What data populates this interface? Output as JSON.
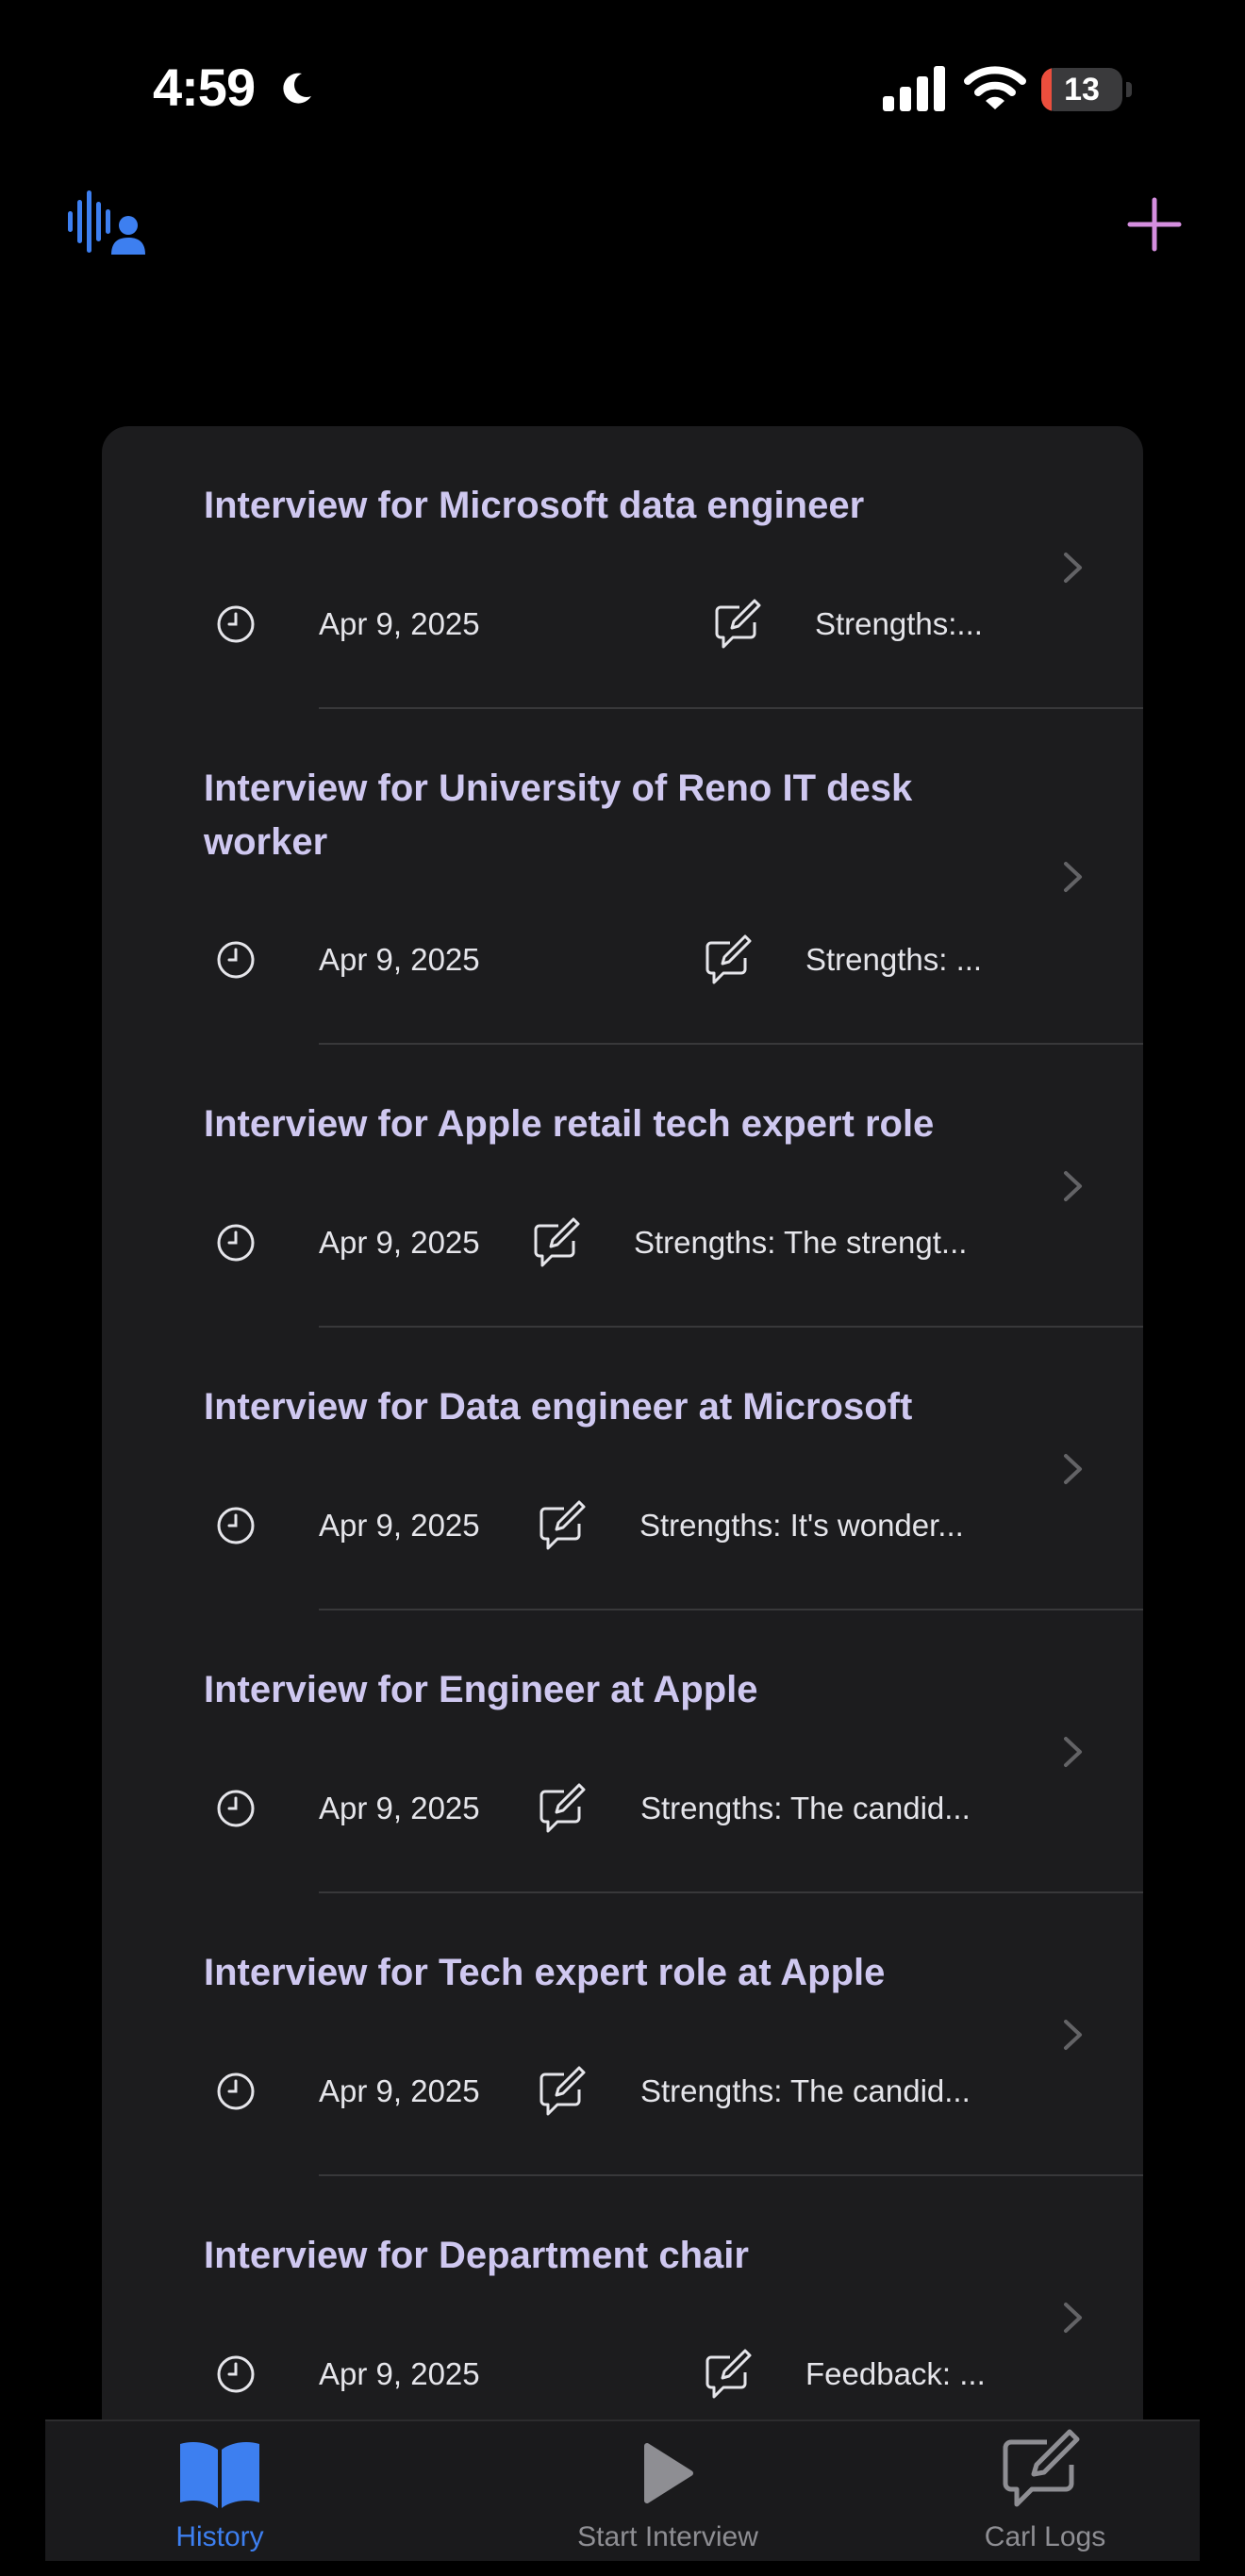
{
  "status": {
    "time": "4:59",
    "battery": "13",
    "battery_level": 0.13
  },
  "nav": {
    "voice_icon": "voice-profile-icon",
    "add_icon": "plus-icon"
  },
  "interviews": [
    {
      "title": "Interview for Microsoft data engineer",
      "date": "Apr 9, 2025",
      "summary": "Strengths:..."
    },
    {
      "title": "Interview for University of Reno IT desk worker",
      "date": "Apr 9, 2025",
      "summary": "Strengths: ..."
    },
    {
      "title": "Interview for Apple retail tech expert role",
      "date": "Apr 9, 2025",
      "summary": "Strengths: The strengt..."
    },
    {
      "title": "Interview for Data engineer at Microsoft",
      "date": "Apr 9, 2025",
      "summary": "Strengths: It's wonder..."
    },
    {
      "title": "Interview for Engineer at Apple",
      "date": "Apr 9, 2025",
      "summary": "Strengths: The candid..."
    },
    {
      "title": "Interview for Tech expert role at Apple",
      "date": "Apr 9, 2025",
      "summary": "Strengths: The candid..."
    },
    {
      "title": "Interview for Department chair",
      "date": "Apr 9, 2025",
      "summary": "Feedback: ..."
    }
  ],
  "tabs": [
    {
      "label": "History",
      "icon": "book-icon",
      "active": true
    },
    {
      "label": "Start Interview",
      "icon": "play-icon",
      "active": false
    },
    {
      "label": "Carl Logs",
      "icon": "compose-icon",
      "active": false
    }
  ],
  "colors": {
    "accent": "#3d7ff0",
    "plus": "#d58fe0",
    "title": "#cfc8f0",
    "inactive": "#8e8e93"
  }
}
